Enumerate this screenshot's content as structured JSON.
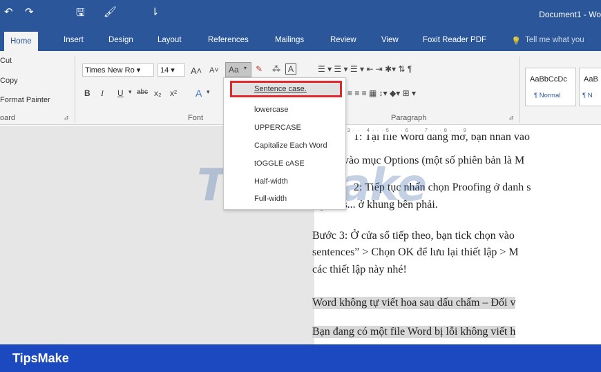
{
  "titlebar": {
    "quick_access": [
      "↶",
      "↷",
      "🖫",
      "🖌",
      "⇂"
    ],
    "doc_title": "Document1 - Wo",
    "color": "#2b579a"
  },
  "tabs": {
    "items": [
      "Home",
      "Insert",
      "Design",
      "Layout",
      "References",
      "Mailings",
      "Review",
      "View",
      "Foxit Reader PDF"
    ],
    "tell_me": "Tell me what you",
    "active": "Home"
  },
  "clipboard": {
    "cut": "Cut",
    "copy": "Copy",
    "format_painter": "Format Painter",
    "group_label": "oard"
  },
  "font": {
    "name": "Times New Ro",
    "size": "14",
    "grow": "A˄",
    "shrink": "A˅",
    "change_case": "Aa",
    "bold": "B",
    "italic": "I",
    "underline": "U",
    "strike": "abc",
    "subscript": "x₂",
    "superscript": "x²",
    "effects": "A",
    "group_label": "Font"
  },
  "paragraph": {
    "row1": "☰ ▾  ☰ ▾  ☰ ▾   ⇤  ⇥   ✱▾   ⇅   ¶",
    "row2": "≡  ≡  ≡  ▦   ↕▾   ◆▾  ⊞ ▾",
    "group_label": "Paragraph"
  },
  "styles": [
    {
      "sample": "AaBbCcDc",
      "name": "¶ Normal"
    },
    {
      "sample": "AaB",
      "name": "¶ N"
    }
  ],
  "ruler": "· · · 2 · · · 3 · · · 4 · · · 5 · · · 6 · · · 7 · · · 8 · · · 9",
  "change_case_menu": [
    "Sentence case.",
    "lowercase",
    "UPPERCASE",
    "Capitalize Each Word",
    "tOGGLE cASE",
    "Half-width",
    "Full-width"
  ],
  "document": {
    "lines": [
      "1: Tại file Word đang mở, bạn nhấn vào",
      "vào mục Options (một số phiên bản là M",
      "2: Tiếp tục nhấn chọn Proofing ở danh s",
      "Options... ở khung bên phải.",
      "Bước 3: Ở cửa sổ tiếp theo, bạn tick chọn vào",
      "sentences” > Chọn OK để lưu lại thiết lập > M",
      "các thiết lập này nhé!",
      "Word không tự viết hoa sau dấu chấm – Đối v",
      "Bạn đang có một file Word bị lỗi không viết h"
    ]
  },
  "watermark": "TipsMake",
  "footer": {
    "brand": "TipsMake",
    "color": "#1c49c0"
  }
}
